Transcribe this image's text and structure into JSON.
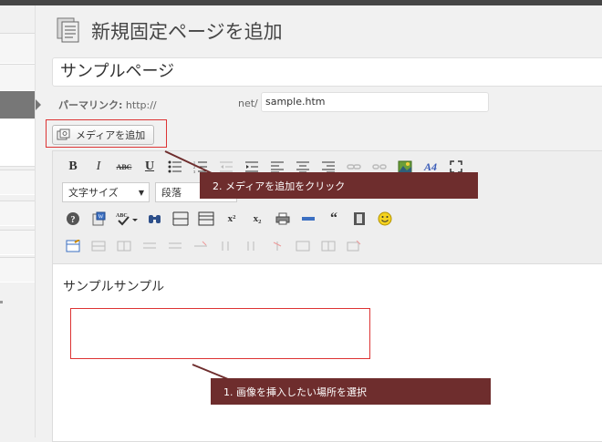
{
  "page": {
    "title": "新規固定ページを追加"
  },
  "post": {
    "title_value": "サンプルページ",
    "permalink_label": "パーマリンク:",
    "permalink_base": "http://",
    "permalink_net": "net/",
    "slug_value": "sample.htm"
  },
  "media": {
    "add_label": "メディアを追加"
  },
  "toolbar": {
    "row1": [
      "bold",
      "italic",
      "strikethrough",
      "underline",
      "bullet-list",
      "numbered-list",
      "outdent",
      "indent",
      "align-left",
      "align-center",
      "align-right",
      "link",
      "unlink",
      "insert-image",
      "spell-a",
      "fullscreen"
    ],
    "format_select": "文字サイズ",
    "paragraph_select": "段落",
    "row3": [
      "help",
      "paste-word",
      "spellcheck",
      "find",
      "insert-table-left",
      "insert-table-right",
      "superscript",
      "subscript",
      "print",
      "hr",
      "blockquote",
      "media",
      "emoticon"
    ]
  },
  "editor": {
    "body_text": "サンプルサンプル"
  },
  "annotations": {
    "step1": "1. 画像を挿入したい場所を選択",
    "step2": "2. メディアを追加をクリック"
  },
  "colors": {
    "callout_bg": "#6e2d2d",
    "highlight": "#dd3333",
    "active_menu": "#777777"
  }
}
